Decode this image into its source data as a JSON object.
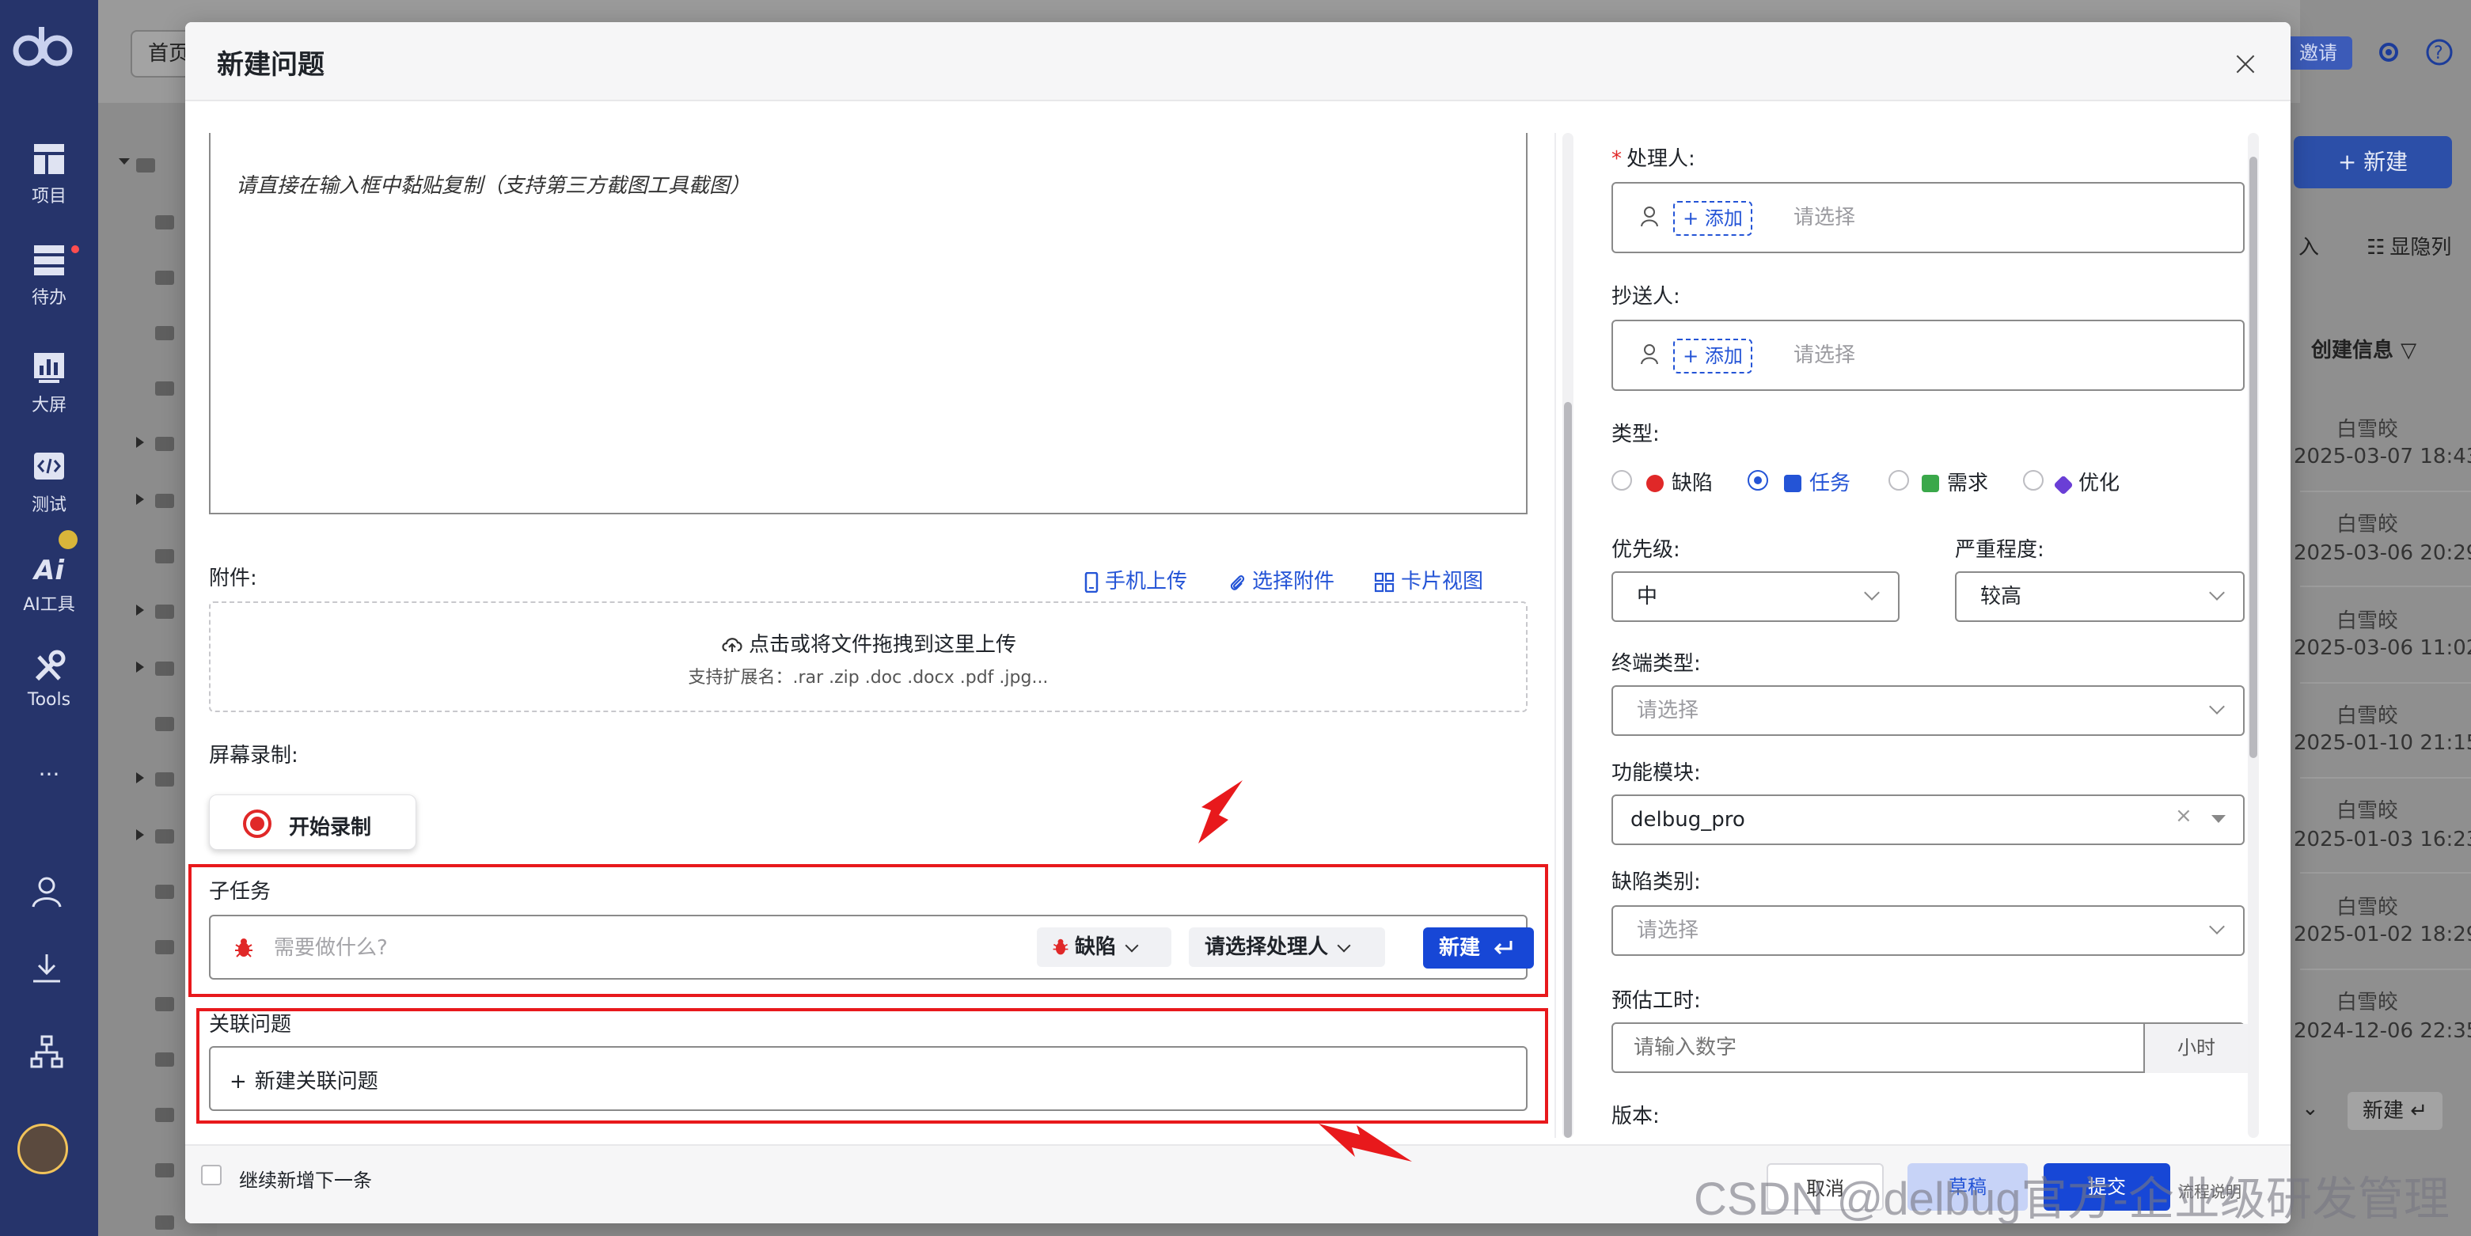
{
  "nav": {
    "items": [
      {
        "label": "项目",
        "icon": "project-icon"
      },
      {
        "label": "待办",
        "icon": "todo-icon"
      },
      {
        "label": "大屏",
        "icon": "dashboard-icon"
      },
      {
        "label": "测试",
        "icon": "test-icon"
      },
      {
        "label": "AI工具",
        "icon": "ai-icon"
      },
      {
        "label": "Tools",
        "icon": "tools-icon"
      }
    ],
    "more": "···"
  },
  "background": {
    "home_tab": "首页",
    "invite": "邀请",
    "new_button": "+ 新建",
    "import_text": "入",
    "show_hidden": "显隐列",
    "creator_header": "创建信息",
    "rows": [
      {
        "name": "白雪皎",
        "date": "2025-03-07 18:43"
      },
      {
        "name": "白雪皎",
        "date": "2025-03-06 20:29"
      },
      {
        "name": "白雪皎",
        "date": "2025-03-06 11:02"
      },
      {
        "name": "白雪皎",
        "date": "2025-01-10 21:15"
      },
      {
        "name": "白雪皎",
        "date": "2025-01-03 16:23"
      },
      {
        "name": "白雪皎",
        "date": "2025-01-02 18:29"
      },
      {
        "name": "白雪皎",
        "date": "2024-12-06 22:35"
      }
    ],
    "bottom_new": "新建"
  },
  "modal": {
    "title": "新建问题",
    "description_placeholder": "请直接在输入框中黏贴复制（支持第三方截图工具截图）",
    "attachments": {
      "label": "附件:",
      "mobile_upload": "手机上传",
      "choose_attachment": "选择附件",
      "card_view": "卡片视图",
      "drop_main": "点击或将文件拖拽到这里上传",
      "drop_sub": "支持扩展名：.rar .zip .doc .docx .pdf .jpg..."
    },
    "screen_record": {
      "label": "屏幕录制:",
      "start": "开始录制"
    },
    "subtask": {
      "label": "子任务",
      "placeholder": "需要做什么?",
      "type": "缺陷",
      "assignee": "请选择处理人",
      "create": "新建"
    },
    "related": {
      "label": "关联问题",
      "create": "新建关联问题"
    },
    "form": {
      "assignee_label": "处理人:",
      "cc_label": "抄送人:",
      "add": "+ 添加",
      "select_ph": "请选择",
      "type_label": "类型:",
      "types": [
        {
          "label": "缺陷",
          "selected": false,
          "color": "#e02828"
        },
        {
          "label": "任务",
          "selected": true,
          "color": "#2454d6"
        },
        {
          "label": "需求",
          "selected": false,
          "color": "#3aa84a"
        },
        {
          "label": "优化",
          "selected": false,
          "color": "#6a3ed6"
        }
      ],
      "priority_label": "优先级:",
      "priority_value": "中",
      "severity_label": "严重程度:",
      "severity_value": "较高",
      "terminal_label": "终端类型:",
      "terminal_ph": "请选择",
      "module_label": "功能模块:",
      "module_value": "delbug_pro",
      "defect_cat_label": "缺陷类别:",
      "defect_cat_ph": "请选择",
      "estimate_label": "预估工时:",
      "estimate_ph": "请输入数字",
      "estimate_unit": "小时",
      "version_label": "版本:"
    },
    "footer": {
      "continue_label": "继续新增下一条",
      "cancel": "取消",
      "draft": "草稿",
      "submit": "提交",
      "flow_note": "流程说明"
    }
  },
  "watermark": "CSDN @delbug官方-企业级研发管理",
  "colors": {
    "nav_bg": "#26346b",
    "primary": "#1747d6",
    "annotation_red": "#e8191c"
  }
}
